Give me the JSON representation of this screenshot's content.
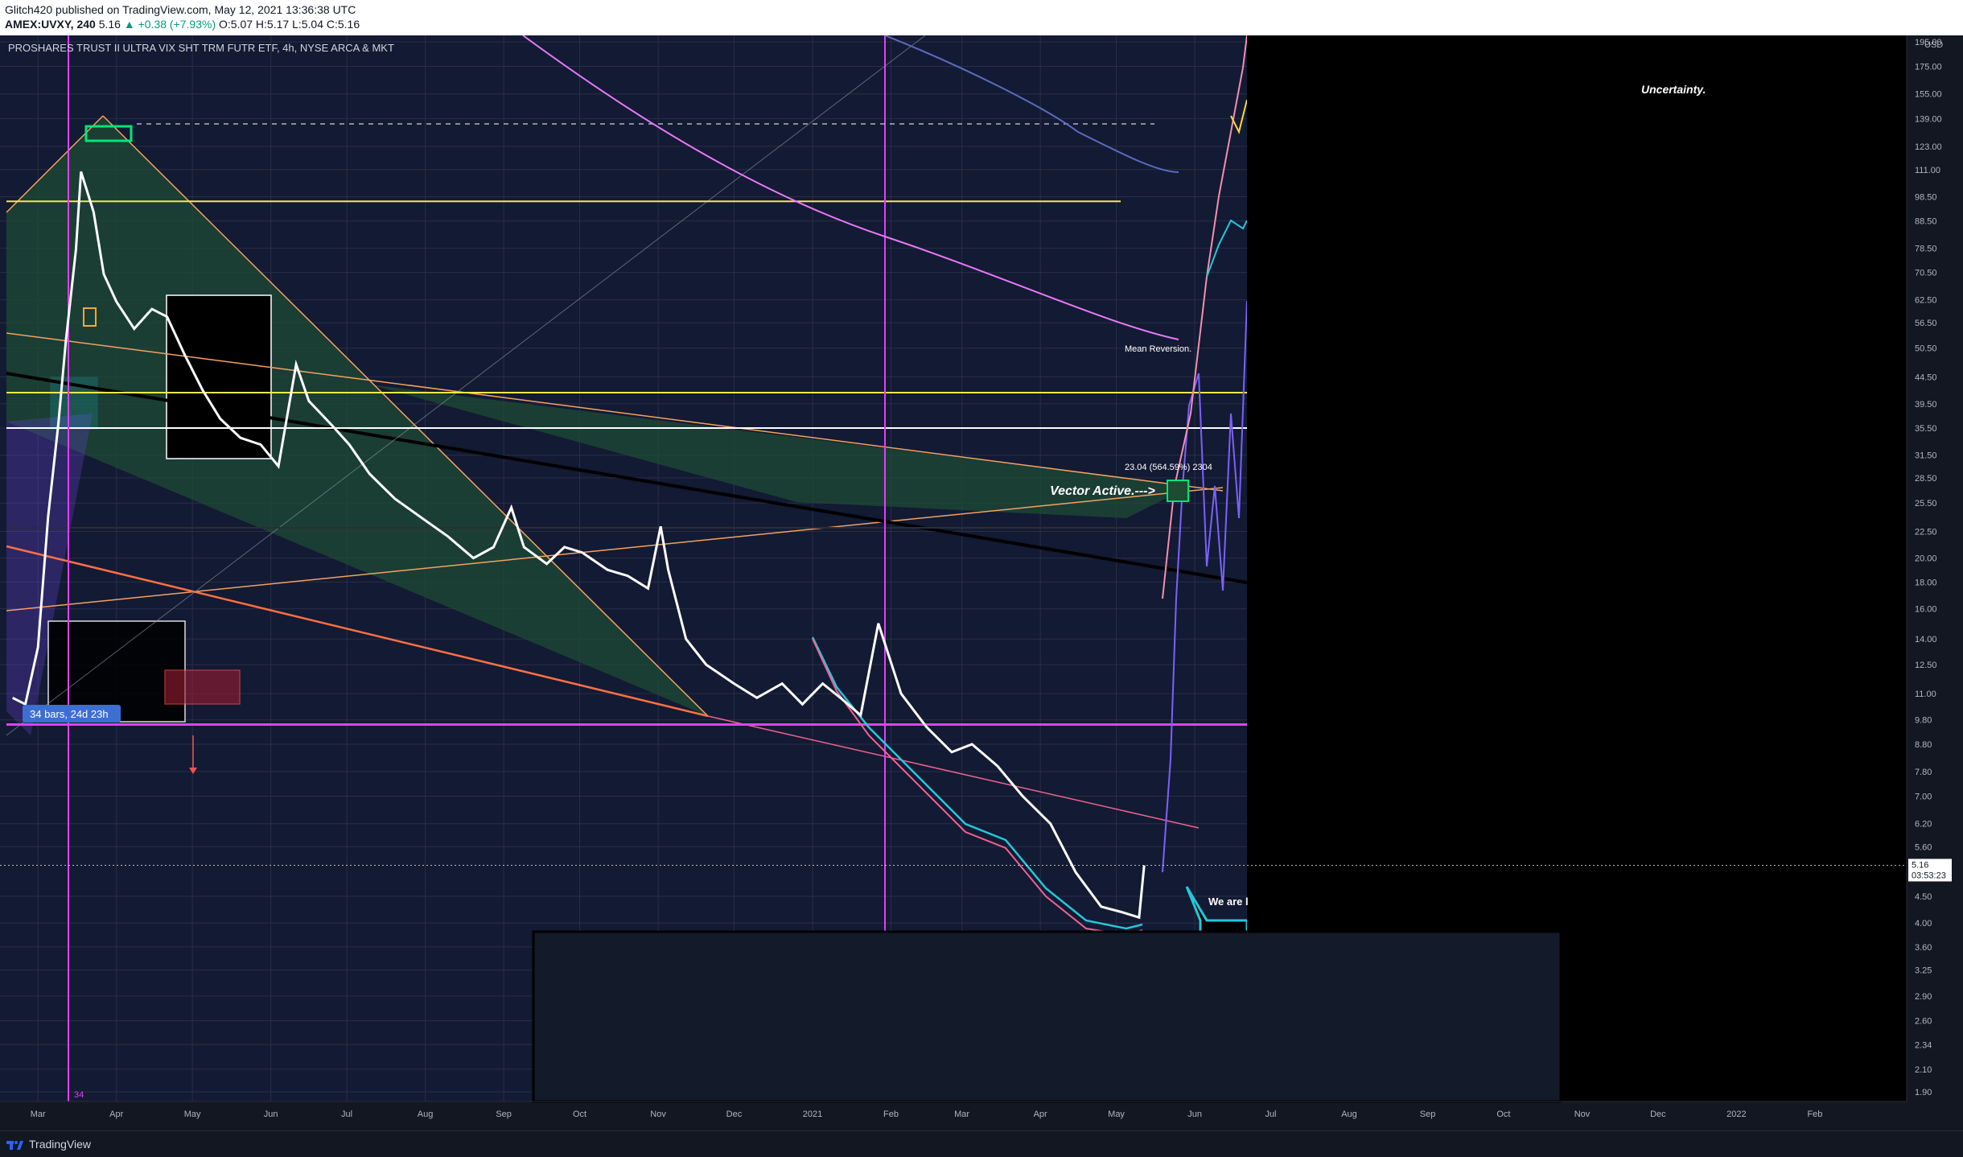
{
  "header": {
    "publish_line": "Glitch420 published on TradingView.com, May 12, 2021 13:36:38 UTC",
    "symbol": "AMEX:UVXY, 240",
    "last": "5.16",
    "change": "▲ +0.38 (+7.93%)",
    "ohlc": "O:5.07  H:5.17  L:5.04  C:5.16"
  },
  "chart_title": "PROSHARES TRUST II ULTRA VIX SHT TRM FUTR ETF, 4h, NYSE ARCA & MKT",
  "currency": "USD",
  "annotations": {
    "uncertainty": "Uncertainty.",
    "mean_reversion": "Mean Reversion.",
    "vector_active": "Vector Active.--->",
    "measure": "23.04 (564.59%) 2304",
    "bars_range": "34 bars, 24d 23h",
    "we_are": "We are l",
    "bar_count": "34"
  },
  "price_tag": {
    "price": "5.16",
    "countdown": "03:53:23"
  },
  "colors": {
    "background": "#131722",
    "price_line": "#ffffff",
    "cyan": "#26c6da",
    "magenta": "#e040fb",
    "yellow": "#f5e94a",
    "orange": "#f4a261",
    "green_fill": "#1f5a3a",
    "purple": "#7b61ff",
    "pink": "#f06292"
  },
  "footer": {
    "brand": "TradingView"
  },
  "chart_data": {
    "type": "line",
    "title": "PROSHARES TRUST II ULTRA VIX SHT TRM FUTR ETF, 4h, NYSE ARCA & MKT",
    "scale": "log",
    "ylim": [
      1.9,
      195
    ],
    "y_ticks": [
      "195.00",
      "175.00",
      "155.00",
      "139.00",
      "123.00",
      "111.00",
      "98.50",
      "88.50",
      "78.50",
      "70.50",
      "62.50",
      "56.50",
      "50.50",
      "44.50",
      "39.50",
      "35.50",
      "31.50",
      "28.50",
      "25.50",
      "22.50",
      "20.00",
      "18.00",
      "16.00",
      "14.00",
      "12.50",
      "11.00",
      "9.80",
      "8.80",
      "7.80",
      "7.00",
      "6.20",
      "5.60",
      "4.50",
      "4.00",
      "3.60",
      "3.25",
      "2.90",
      "2.60",
      "2.34",
      "2.10",
      "1.90"
    ],
    "x_ticks": [
      "Mar",
      "Apr",
      "May",
      "Jun",
      "Jul",
      "Aug",
      "Sep",
      "Oct",
      "Nov",
      "Dec",
      "2021",
      "Feb",
      "Mar",
      "Apr",
      "May",
      "Jun",
      "Jul",
      "Aug",
      "Sep",
      "Oct",
      "Nov",
      "Dec",
      "2022",
      "Feb"
    ],
    "series": [
      {
        "name": "",
        "color": "#ffffff",
        "x": [
          "2020-02-20",
          "2020-02-25",
          "2020-03-01",
          "2020-03-05",
          "2020-03-09",
          "2020-03-12",
          "2020-03-16",
          "2020-03-18",
          "2020-03-23",
          "2020-03-27",
          "2020-04-01",
          "2020-04-08",
          "2020-04-15",
          "2020-04-21",
          "2020-04-28",
          "2020-05-05",
          "2020-05-12",
          "2020-05-20",
          "2020-05-28",
          "2020-06-04",
          "2020-06-11",
          "2020-06-16",
          "2020-06-25",
          "2020-07-02",
          "2020-07-10",
          "2020-07-20",
          "2020-07-30",
          "2020-08-10",
          "2020-08-20",
          "2020-08-28",
          "2020-09-04",
          "2020-09-09",
          "2020-09-18",
          "2020-09-25",
          "2020-10-02",
          "2020-10-12",
          "2020-10-20",
          "2020-10-28",
          "2020-11-02",
          "2020-11-05",
          "2020-11-12",
          "2020-11-20",
          "2020-12-01",
          "2020-12-10",
          "2020-12-20",
          "2020-12-28",
          "2021-01-05",
          "2021-01-12",
          "2021-01-20",
          "2021-01-27",
          "2021-02-05",
          "2021-02-15",
          "2021-02-25",
          "2021-03-05",
          "2021-03-15",
          "2021-03-25",
          "2021-04-05",
          "2021-04-15",
          "2021-04-25",
          "2021-05-03",
          "2021-05-10",
          "2021-05-12"
        ],
        "values": [
          10.8,
          10.5,
          13.5,
          24,
          36,
          52,
          78,
          110,
          92,
          70,
          62,
          55,
          60,
          58,
          49,
          42,
          37,
          34,
          33,
          30,
          47,
          40,
          36,
          33,
          29,
          26,
          24,
          22,
          20,
          21,
          25,
          21,
          19.5,
          21,
          20.5,
          19,
          18.5,
          17.5,
          23,
          19,
          14,
          12.5,
          11.5,
          10.8,
          11.5,
          10.5,
          11.5,
          10.8,
          10,
          15,
          11,
          9.5,
          8.5,
          8.8,
          8,
          7,
          6.2,
          5,
          4.3,
          4.2,
          4.1,
          5.16
        ]
      }
    ],
    "horizontal_levels": [
      {
        "value": 96.5,
        "color": "#f5e94a"
      },
      {
        "value": 41.5,
        "color": "#f5e94a"
      },
      {
        "value": 35.5,
        "color": "#ffffff"
      },
      {
        "value": 9.6,
        "color": "#e040fb"
      }
    ],
    "vertical_markers": [
      "2020-03-01",
      "2021-01-14"
    ]
  }
}
